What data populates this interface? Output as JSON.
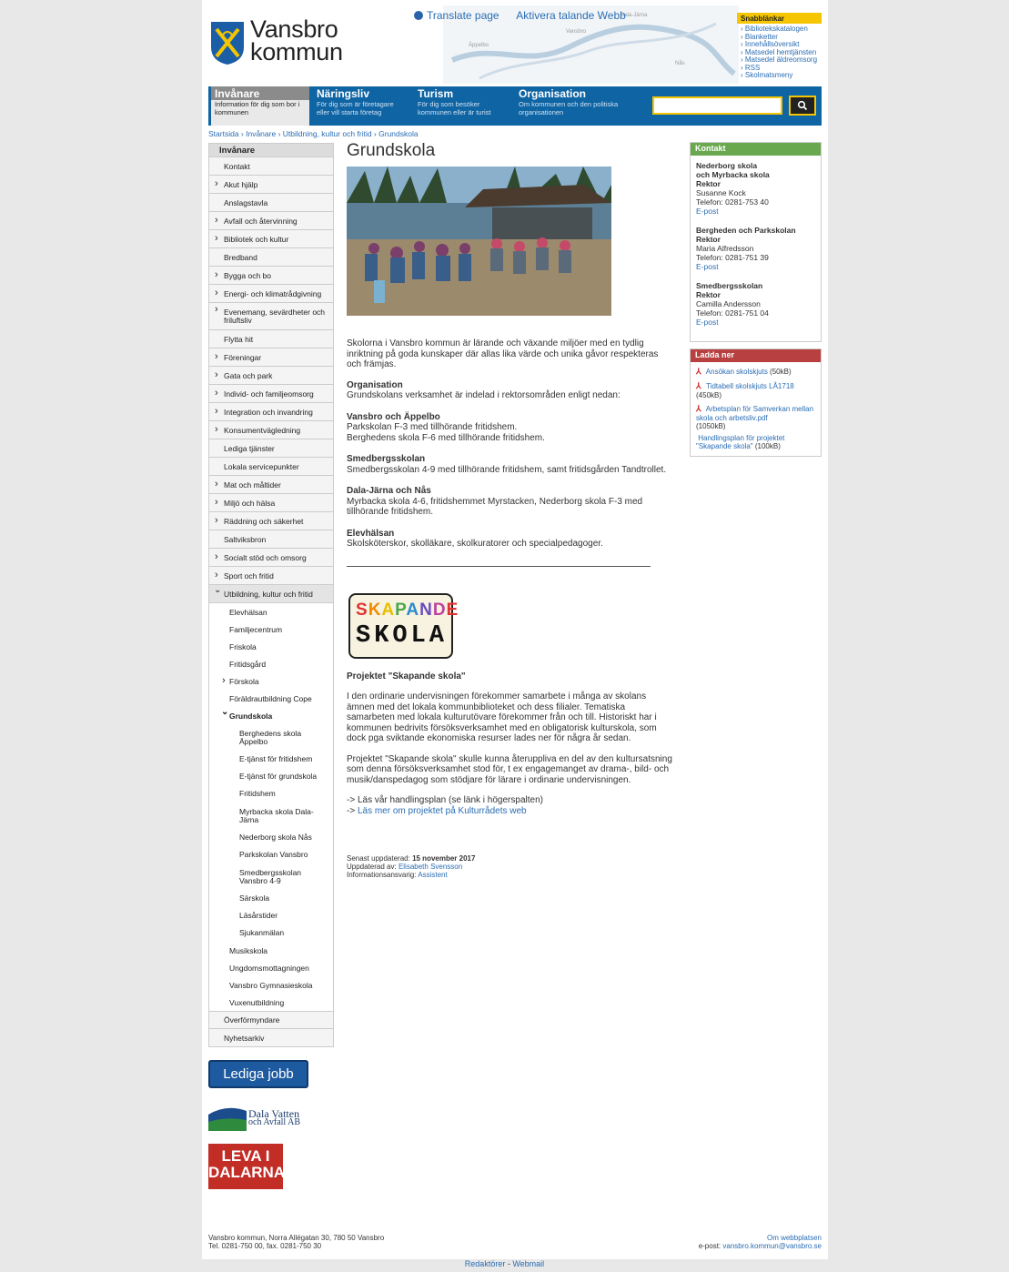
{
  "header": {
    "logo_line1": "Vansbro",
    "logo_line2": "kommun",
    "translate": "Translate page",
    "speech": "Aktivera talande Webb",
    "map_labels": [
      "Dala-Järna",
      "Vansbro",
      "Äppelbo",
      "Nås"
    ]
  },
  "quicklinks": {
    "title": "Snabblänkar",
    "items": [
      "Bibliotekskatalogen",
      "Blanketter",
      "Innehållsöversikt",
      "Matsedel hemtjänsten",
      "Matsedel äldreomsorg",
      "RSS",
      "Skolmatsmeny"
    ]
  },
  "topnav": [
    {
      "title": "Invånare",
      "desc": "Information för dig som bor i kommunen"
    },
    {
      "title": "Näringsliv",
      "desc": "För dig som är företagare eller vill starta företag"
    },
    {
      "title": "Turism",
      "desc": "För dig som besöker kommunen eller är turist"
    },
    {
      "title": "Organisation",
      "desc": "Om kommunen och den politiska organisationen"
    }
  ],
  "breadcrumb": [
    "Startsida",
    "Invånare",
    "Utbildning, kultur och fritid",
    "Grundskola"
  ],
  "leftnav": {
    "heading": "Invånare",
    "items": [
      "Kontakt",
      "Akut hjälp",
      "Anslagstavla",
      "Avfall och återvinning",
      "Bibliotek och kultur",
      "Bredband",
      "Bygga och bo",
      "Energi- och klimatrådgivning",
      "Evenemang, sevärdheter och friluftsliv",
      "Flytta hit",
      "Föreningar",
      "Gata och park",
      "Individ- och familjeomsorg",
      "Integration och invandring",
      "Konsumentvägledning",
      "Lediga tjänster",
      "Lokala servicepunkter",
      "Mat och måltider",
      "Miljö och hälsa",
      "Räddning och säkerhet",
      "Saltviksbron",
      "Socialt stöd och omsorg",
      "Sport och fritid",
      "Utbildning, kultur och fritid"
    ],
    "sub": [
      "Elevhälsan",
      "Familjecentrum",
      "Friskola",
      "Fritidsgård",
      "Förskola",
      "Föräldrautbildning Cope",
      "Grundskola"
    ],
    "sub2": [
      "Berghedens skola Äppelbo",
      "E-tjänst för fritidshem",
      "E-tjänst för grundskola",
      "Fritidshem",
      "Myrbacka skola Dala-Järna",
      "Nederborg skola Nås",
      "Parkskolan Vansbro",
      "Smedbergsskolan Vansbro 4-9",
      "Särskola",
      "Läsårstider",
      "Sjukanmälan"
    ],
    "sub3": [
      "Musikskola",
      "Ungdomsmottagningen",
      "Vansbro Gymnasieskola",
      "Vuxenutbildning"
    ],
    "tail": [
      "Överförmyndare",
      "Nyhetsarkiv"
    ]
  },
  "banners": {
    "jobs": "Lediga jobb",
    "dala1": "Dala Vatten",
    "dala2": "och Avfall AB",
    "leva1": "LEVA I",
    "leva2": "DALARNA"
  },
  "main": {
    "title": "Grundskola",
    "intro": "Skolorna i Vansbro kommun är lärande och växande miljöer med en tydlig inriktning på goda kunskaper där allas lika värde och unika gåvor respekteras och främjas.",
    "org_h": "Organisation",
    "org_t": "Grundskolans verksamhet är indelad i rektorsområden enligt nedan:",
    "s1_h": "Vansbro och Äppelbo",
    "s1_t1": "Parkskolan F-3 med tillhörande fritidshem.",
    "s1_t2": "Berghedens skola F-6 med tillhörande fritidshem.",
    "s2_h": "Smedbergsskolan",
    "s2_t": "Smedbergsskolan 4-9 med tillhörande fritidshem, samt fritidsgården Tandtrollet.",
    "s3_h": "Dala-Järna och Nås",
    "s3_t": "Myrbacka skola 4-6, fritidshemmet Myrstacken, Nederborg skola F-3 med tillhörande fritidshem.",
    "s4_h": "Elevhälsan",
    "s4_t": "Skolsköterskor, skolläkare, skolkuratorer och specialpedagoger.",
    "logo_top": "SKAPANDE",
    "logo_bottom": "SKOLA",
    "proj_h": "Projektet \"Skapande skola\"",
    "proj_p1": "I den ordinarie undervisningen förekommer samarbete i många av skolans ämnen med det lokala kommunbiblioteket och dess filialer. Tematiska samarbeten med lokala kulturutövare förekommer från och till. Historiskt har i kommunen bedrivits försöksverksamhet med en obligatorisk kulturskola, som dock pga sviktande ekonomiska resurser lades ner för några år sedan.",
    "proj_p2": "Projektet \"Skapande skola\" skulle kunna återuppliva en del av den kultursatsning som denna försöksverksamhet stod för, t ex engagemanget av drama-, bild- och musik/danspedagog som stödjare för lärare i ordinarie undervisningen.",
    "link1": "-> Läs vår handlingsplan (se länk i högerspalten)",
    "link2_pre": "-> ",
    "link2": "Läs mer om projektet på Kulturrådets web",
    "updated_l": "Senast uppdaterad: ",
    "updated_v": "15 november 2017",
    "by_l": "Uppdaterad av: ",
    "by_v": "Elisabeth Svensson",
    "resp_l": "Informationsansvarig: ",
    "resp_v": "Assistent"
  },
  "contact": {
    "title": "Kontakt",
    "c1": {
      "name1": "Nederborg skola",
      "name2": "och Myrbacka skola",
      "role": "Rektor",
      "person": "Susanne Kock",
      "phone": "Telefon: 0281-753 40",
      "email": "E-post"
    },
    "c2": {
      "name1": "Bergheden och Parkskolan",
      "role": "Rektor",
      "person": "Maria Alfredsson",
      "phone": "Telefon: 0281-751 39",
      "email": "E-post"
    },
    "c3": {
      "name1": "Smedbergsskolan",
      "role": "Rektor",
      "person": "Camilla Andersson",
      "phone": "Telefon: 0281-751 04",
      "email": "E-post"
    }
  },
  "downloads": {
    "title": "Ladda ner",
    "d1": "Ansökan skolskjuts",
    "d1s": "(50kB)",
    "d2": "Tidtabell skolskjuts LÅ1718",
    "d2s": "(450kB)",
    "d3": "Arbetsplan för Samverkan mellan skola och arbetsliv.pdf",
    "d3s": "(1050kB)",
    "d4": "Handlingsplan för projektet \"Skapande skola\"",
    "d4s": "(100kB)"
  },
  "footer": {
    "addr": "Vansbro kommun, Norra Allégatan 30, 780 50 Vansbro",
    "tel": "Tel. 0281-750 00, fax. 0281-750 30",
    "about": "Om webbplatsen",
    "email_l": "e-post: ",
    "email": "vansbro.kommun@vansbro.se",
    "editors": "Redaktörer",
    "sep": " - ",
    "webmail": "Webmail"
  },
  "colors": {
    "nav": "#0f64a3",
    "accent": "#f4c500",
    "contact": "#6aa84f",
    "download": "#b84040"
  }
}
